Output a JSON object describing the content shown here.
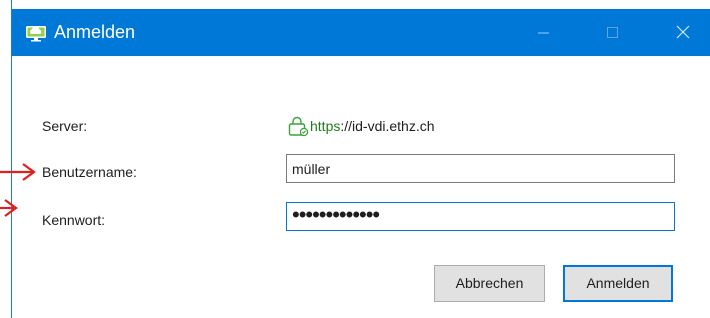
{
  "window": {
    "title": "Anmelden",
    "title_icon": "cloud-monitor-icon",
    "controls": [
      "minimize-icon",
      "maximize-icon",
      "close-icon"
    ]
  },
  "form": {
    "server_label": "Server:",
    "server_protocol": "https",
    "server_host": "://id-vdi.ethz.ch",
    "server_icon": "lock-icon",
    "username_label": "Benutzername:",
    "username_value": "müller",
    "password_label": "Kennwort:",
    "password_value": "•••••••••••••"
  },
  "buttons": {
    "cancel_label": "Abbrechen",
    "login_label": "Anmelden"
  },
  "annotations": {
    "arrow_color": "#e0201b"
  }
}
